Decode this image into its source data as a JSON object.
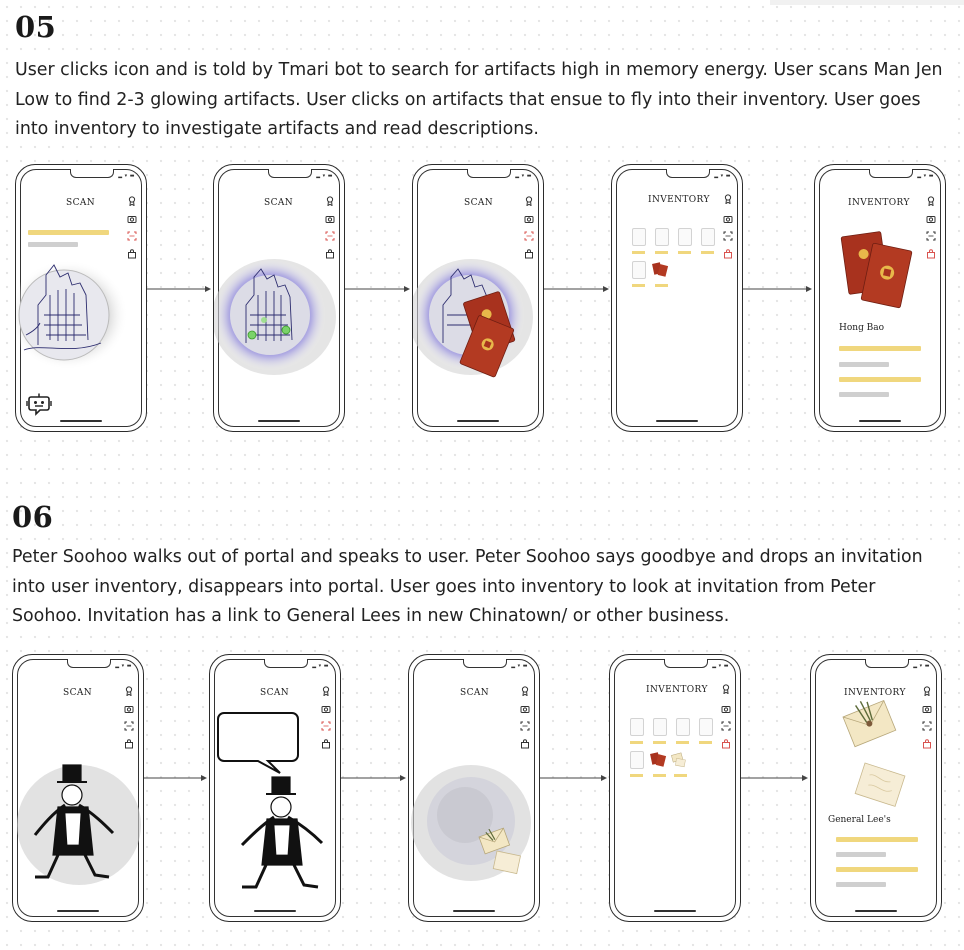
{
  "sections": [
    {
      "number": "05",
      "description_lines": [
        "User clicks icon and is told by Tmari bot to search for artifacts high in memory energy. User scans Man Jen",
        "Low to find 2-3 glowing artifacts.  User clicks on artifacts that ensue to fly into their inventory. User goes",
        "into inventory to investigate artifacts and read descriptions."
      ],
      "screens": [
        {
          "title": "SCAN"
        },
        {
          "title": "SCAN"
        },
        {
          "title": "SCAN"
        },
        {
          "title": "INVENTORY"
        },
        {
          "title": "INVENTORY",
          "item_label": "Hong Bao"
        }
      ]
    },
    {
      "number": "06",
      "description_lines": [
        "Peter Soohoo walks out of portal and speaks to user. Peter Soohoo says goodbye and drops an invitation",
        "into user inventory, disappears into portal. User goes into inventory to look at invitation from Peter",
        "Soohoo. Invitation has a link to General Lees in new Chinatown/ or other business."
      ],
      "screens": [
        {
          "title": "SCAN"
        },
        {
          "title": "SCAN"
        },
        {
          "title": "SCAN"
        },
        {
          "title": "INVENTORY"
        },
        {
          "title": "INVENTORY",
          "item_label": "General Lee's"
        }
      ]
    }
  ],
  "colors": {
    "accent_yellow": "#f0d77e",
    "placeholder_gray": "#cfcfcf",
    "active_red": "#d9534f",
    "envelope_red": "#a8321e",
    "glow_purple": "#4a3fd1"
  },
  "icons": [
    "award-icon",
    "camera-icon",
    "scan-icon",
    "bag-icon",
    "bot-icon",
    "chevron-right-icon"
  ]
}
